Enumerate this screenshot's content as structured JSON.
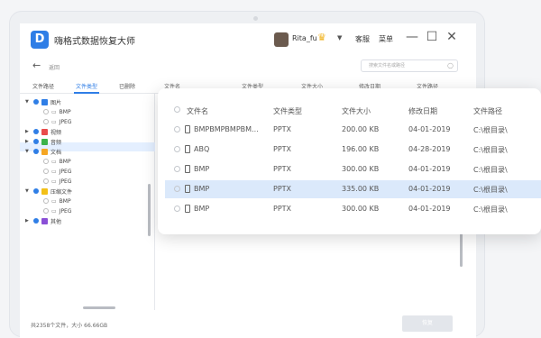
{
  "app": {
    "title": "嗨格式数据恢复大师",
    "user": "Rita_fu",
    "link1": "客服",
    "link2": "菜单",
    "minimize": "—",
    "maximize": "☐",
    "close": "✕"
  },
  "nav": {
    "back_icon": "←",
    "back_label": "返回",
    "search_placeholder": "搜索文件名或路径"
  },
  "tabs": {
    "path": "文件路径",
    "type": "文件类型",
    "deleted": "已删除"
  },
  "list_headers": [
    "文件名",
    "文件类型",
    "文件大小",
    "修改日期",
    "文件路径"
  ],
  "tree": [
    {
      "label": "图片",
      "level": 0,
      "expanded": true,
      "checked": true,
      "color": "#2f7ee6"
    },
    {
      "label": "BMP",
      "level": 1,
      "checked": false
    },
    {
      "label": "JPEG",
      "level": 1,
      "checked": false
    },
    {
      "label": "视频",
      "level": 0,
      "expanded": false,
      "checked": true,
      "color": "#e94b4b"
    },
    {
      "label": "音频",
      "level": 0,
      "expanded": false,
      "checked": true,
      "color": "#3bb34a"
    },
    {
      "label": "文档",
      "level": 0,
      "expanded": true,
      "checked": true,
      "color": "#f5a623"
    },
    {
      "label": "BMP",
      "level": 1,
      "checked": false
    },
    {
      "label": "JPEG",
      "level": 1,
      "checked": false
    },
    {
      "label": "JPEG",
      "level": 1,
      "checked": false
    },
    {
      "label": "压缩文件",
      "level": 0,
      "expanded": true,
      "checked": true,
      "color": "#f3c017"
    },
    {
      "label": "BMP",
      "level": 1,
      "checked": false
    },
    {
      "label": "JPEG",
      "level": 1,
      "checked": false
    },
    {
      "label": "其他",
      "level": 0,
      "expanded": false,
      "checked": true,
      "color": "#8a4fd6"
    }
  ],
  "status": "共2358个文件，大小 66.66GB",
  "recover_label": "恢复",
  "popup": {
    "headers": [
      "文件名",
      "文件类型",
      "文件大小",
      "修改日期",
      "文件路径"
    ],
    "rows": [
      {
        "name": "BMPBMPBMPBM...",
        "type": "PPTX",
        "size": "200.00 KB",
        "date": "04-01-2019",
        "path": "C:\\根目录\\"
      },
      {
        "name": "ABQ",
        "type": "PPTX",
        "size": "196.00 KB",
        "date": "04-28-2019",
        "path": "C:\\根目录\\"
      },
      {
        "name": "BMP",
        "type": "PPTX",
        "size": "300.00 KB",
        "date": "04-01-2019",
        "path": "C:\\根目录\\"
      },
      {
        "name": "BMP",
        "type": "PPTX",
        "size": "335.00 KB",
        "date": "04-01-2019",
        "path": "C:\\根目录\\"
      },
      {
        "name": "BMP",
        "type": "PPTX",
        "size": "300.00 KB",
        "date": "04-01-2019",
        "path": "C:\\根目录\\"
      }
    ]
  },
  "colors": {
    "accent": "#2f7ee6",
    "highlight": "#dbe9fb"
  }
}
